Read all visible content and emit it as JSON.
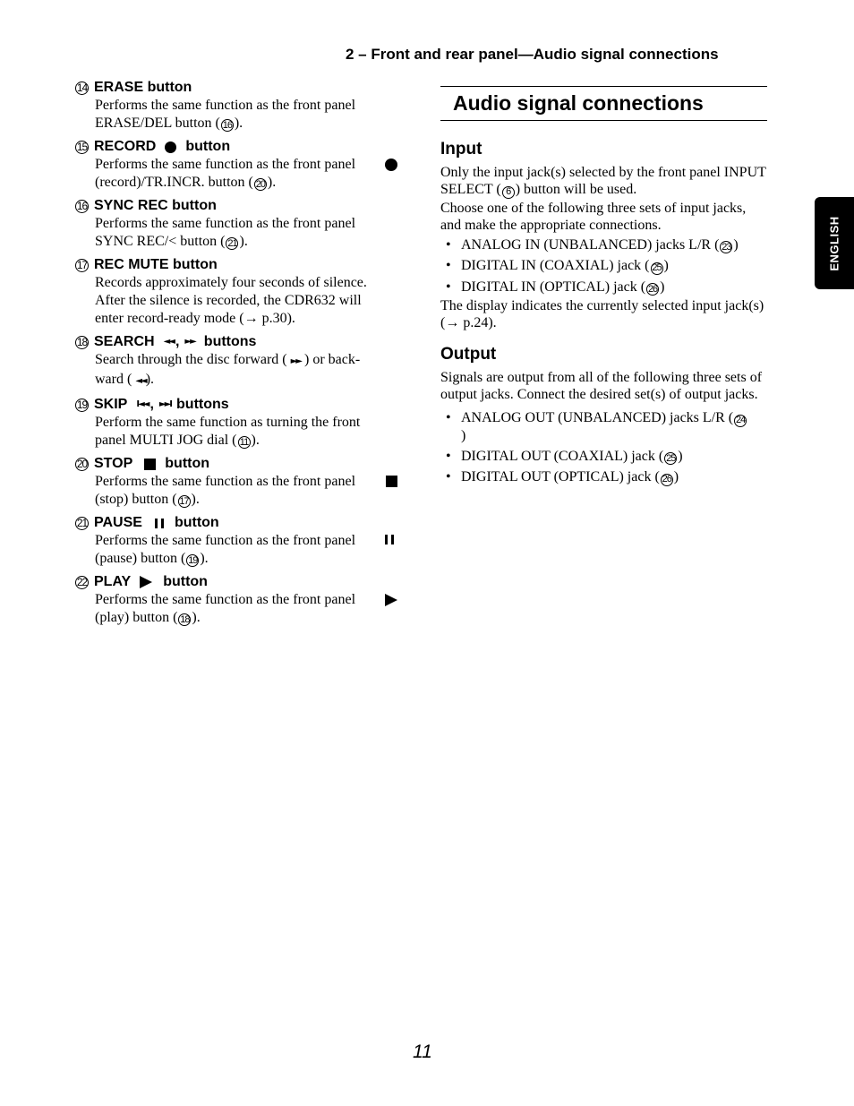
{
  "header": {
    "running_head": "2 – Front and rear panel—Audio signal connections"
  },
  "side_tab": {
    "label": "ENGLISH"
  },
  "left_items": [
    {
      "num": "14",
      "title": "ERASE button",
      "line1": "Performs the same function as the front panel",
      "line2_pre": "ERASE/DEL button (",
      "ref": "16",
      "line2_post": ")."
    },
    {
      "num": "15",
      "title_pre": "RECORD",
      "title_post": "button",
      "symbol": "record-dot",
      "line1": "Performs the same function as the front panel",
      "line2_pre": "(record)/TR.INCR. button (",
      "ref": "20",
      "line2_post": ")."
    },
    {
      "num": "16",
      "title": "SYNC REC button",
      "line1": "Performs the same function as the front panel",
      "line2_pre": "SYNC REC/< button (",
      "ref": "21",
      "line2_post": ")."
    },
    {
      "num": "17",
      "title": "REC MUTE button",
      "line1": "Records approximately four seconds of silence.",
      "line2": "After the silence is recorded, the CDR632 will",
      "line3": "enter record-ready mode (→ p.30)."
    },
    {
      "num": "18",
      "title_pre": "SEARCH",
      "title_sym1": "◄◄",
      "title_sep": ",",
      "title_sym2": "►►",
      "title_post": "buttons",
      "line1_pre": "Search through the disc forward (",
      "line1_sym": "►►",
      "line1_post": ") or back-",
      "line2_pre": "ward (",
      "line2_sym": "◄◄",
      "line2_post": ")."
    },
    {
      "num": "19",
      "title_pre": "SKIP",
      "title_sym1": "I◄◄",
      "title_sep": ",",
      "title_sym2": "►►I",
      "title_post": "buttons",
      "line1": "Perform the same function as turning the front",
      "line2_pre": "panel MULTI JOG dial (",
      "ref": "11",
      "line2_post": ")."
    },
    {
      "num": "20",
      "title_pre": "STOP",
      "title_post": "button",
      "symbol": "stop-square",
      "line1": "Performs the same function as the front panel",
      "line2_pre": "(stop) button (",
      "ref": "17",
      "line2_post": ")."
    },
    {
      "num": "21",
      "title_pre": "PAUSE",
      "title_post": "button",
      "symbol": "pause-bars",
      "line1": "Performs the same function as the front panel",
      "line2_pre": "(pause) button (",
      "ref": "19",
      "line2_post": ")."
    },
    {
      "num": "22",
      "title_pre": "PLAY",
      "title_post": "button",
      "symbol": "play-triangle",
      "line1": "Performs the same function as the front panel",
      "line2_pre": "(play) button (",
      "ref": "18",
      "line2_post": ")."
    }
  ],
  "right": {
    "section_title": "Audio signal connections",
    "input": {
      "heading": "Input",
      "para1_pre": "Only the input jack(s) selected by the front panel INPUT SELECT (",
      "para1_ref": "6",
      "para1_post": ") button will be used.",
      "para2": "Choose one of the following three sets of input jacks, and make the appropriate connections.",
      "bullets": [
        {
          "pre": "ANALOG IN (UNBALANCED) jacks L/R (",
          "ref": "23",
          "post": ")"
        },
        {
          "pre": "DIGITAL IN (COAXIAL) jack (",
          "ref": "25",
          "post": ")"
        },
        {
          "pre": "DIGITAL IN (OPTICAL) jack (",
          "ref": "26",
          "post": ")"
        }
      ],
      "para3": "The display indicates the currently selected input jack(s) (→ p.24)."
    },
    "output": {
      "heading": "Output",
      "para1": "Signals are output from all of the following three sets of output jacks. Connect the desired set(s) of output jacks.",
      "bullets": [
        {
          "pre": "ANALOG OUT (UNBALANCED) jacks L/R (",
          "ref": "24",
          "post": ")"
        },
        {
          "pre": "DIGITAL OUT (COAXIAL) jack (",
          "ref": "25",
          "post": ")"
        },
        {
          "pre": "DIGITAL OUT (OPTICAL) jack (",
          "ref": "26",
          "post": ")"
        }
      ]
    }
  },
  "footer": {
    "page_number": "11"
  }
}
